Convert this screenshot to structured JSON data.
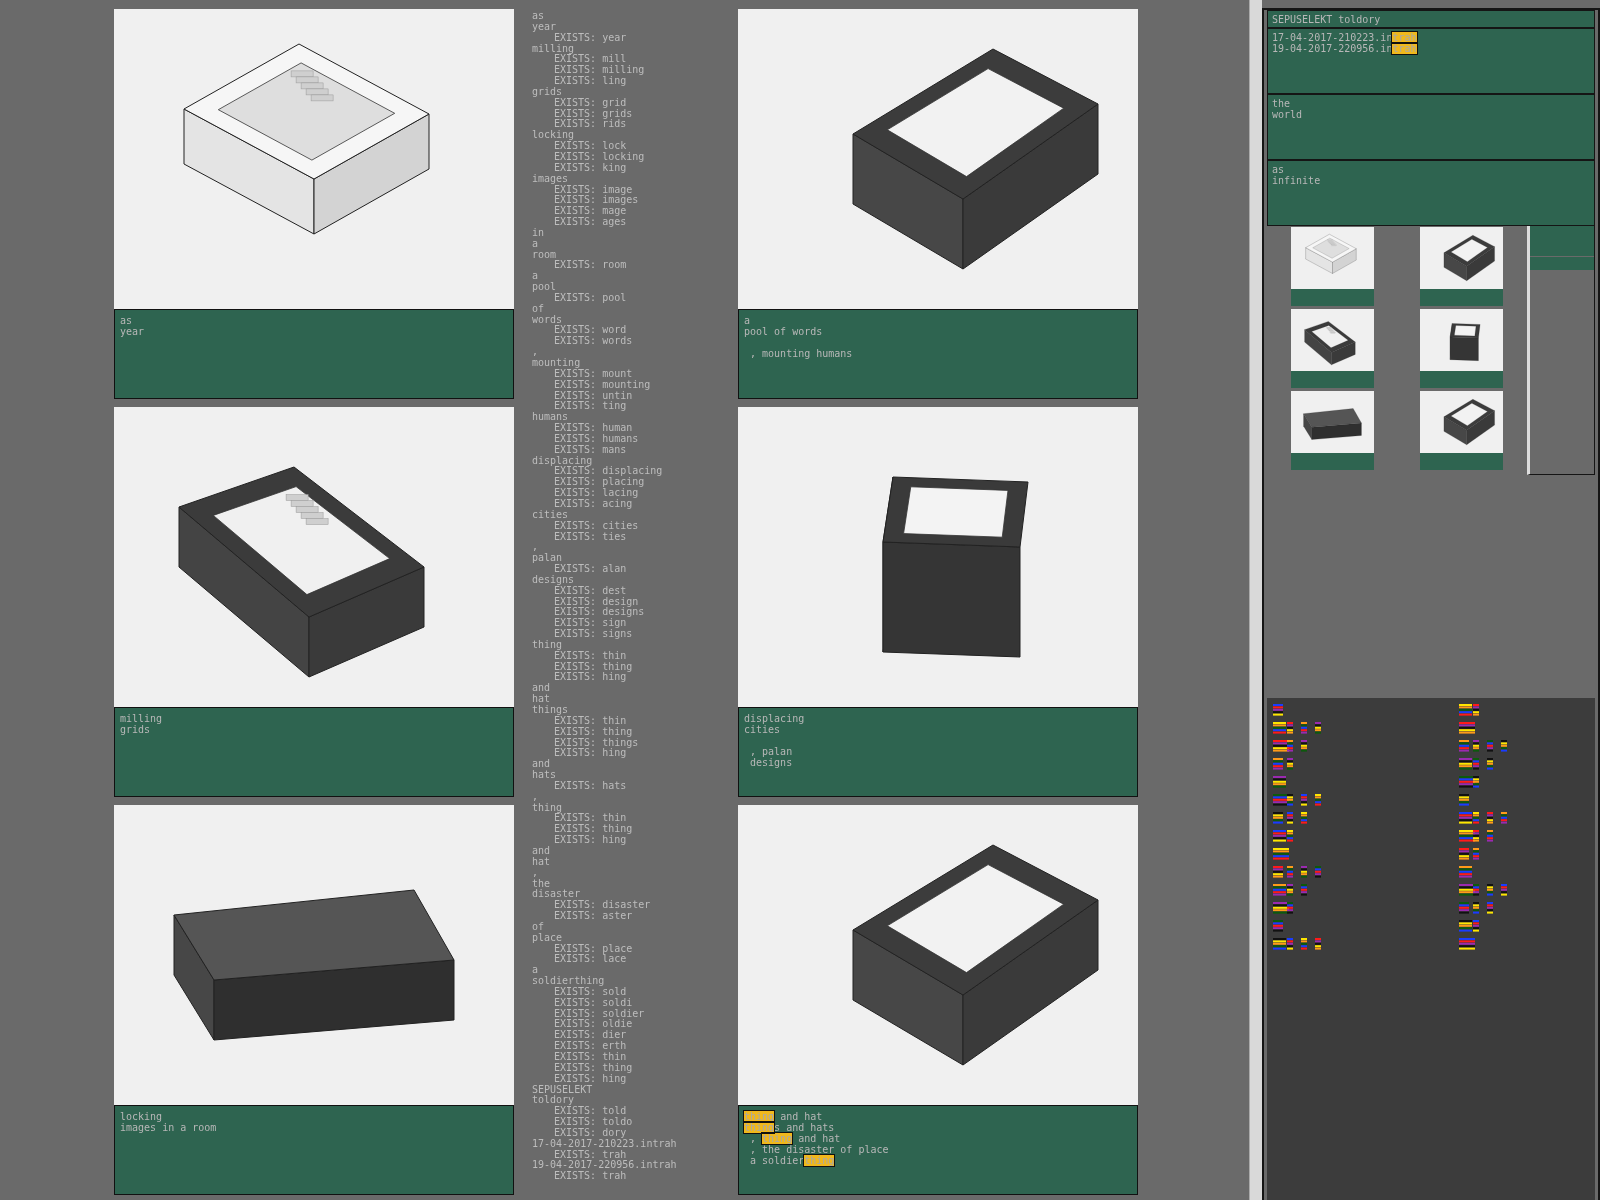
{
  "cards": [
    {
      "image": {
        "kind": "open-white"
      },
      "caption": [
        {
          "segments": [
            {
              "text": "as",
              "highlighted": false
            }
          ]
        },
        {
          "segments": [
            {
              "text": "year",
              "highlighted": false
            }
          ]
        }
      ]
    },
    {
      "image": {
        "kind": "open-dark"
      },
      "caption": [
        {
          "segments": [
            {
              "text": "a",
              "highlighted": false
            }
          ]
        },
        {
          "segments": [
            {
              "text": "pool of words",
              "highlighted": false
            }
          ]
        },
        {
          "gap_above": true,
          "segments": [
            {
              "text": " , mounting humans",
              "highlighted": false
            }
          ]
        }
      ]
    },
    {
      "image": {
        "kind": "open-dark-stairs"
      },
      "caption": [
        {
          "segments": [
            {
              "text": "milling",
              "highlighted": false
            }
          ]
        },
        {
          "segments": [
            {
              "text": "grids",
              "highlighted": false
            }
          ]
        }
      ]
    },
    {
      "image": {
        "kind": "tall-dark"
      },
      "caption": [
        {
          "segments": [
            {
              "text": "displacing",
              "highlighted": false
            }
          ]
        },
        {
          "segments": [
            {
              "text": "cities",
              "highlighted": false
            }
          ]
        },
        {
          "gap_above": true,
          "segments": [
            {
              "text": " , palan",
              "highlighted": false
            }
          ]
        },
        {
          "segments": [
            {
              "text": " designs",
              "highlighted": false
            }
          ]
        }
      ]
    },
    {
      "image": {
        "kind": "closed-dark"
      },
      "caption": [
        {
          "segments": [
            {
              "text": "locking",
              "highlighted": false
            }
          ]
        },
        {
          "segments": [
            {
              "text": "images in a room",
              "highlighted": false
            }
          ]
        }
      ]
    },
    {
      "image": {
        "kind": "open-dark"
      },
      "caption": [
        {
          "segments": [
            {
              "text": "thing",
              "highlighted": true
            },
            {
              "text": " and hat",
              "highlighted": false
            }
          ]
        },
        {
          "segments": [
            {
              "text": "thing",
              "highlighted": true
            },
            {
              "text": "s and hats",
              "highlighted": false
            }
          ]
        },
        {
          "segments": [
            {
              "text": " , ",
              "highlighted": false
            },
            {
              "text": "thing",
              "highlighted": true
            },
            {
              "text": " and hat",
              "highlighted": false
            }
          ]
        },
        {
          "segments": [
            {
              "text": " , the disaster of place",
              "highlighted": false
            }
          ]
        },
        {
          "segments": [
            {
              "text": " a soldier",
              "highlighted": false
            },
            {
              "text": "thing",
              "highlighted": true
            }
          ]
        }
      ]
    }
  ],
  "wordlist": [
    {
      "word": "as"
    },
    {
      "word": "year",
      "exists": [
        "EXISTS: year"
      ]
    },
    {
      "word": "milling",
      "exists": [
        "EXISTS: mill",
        "EXISTS: milling",
        "EXISTS: ling"
      ]
    },
    {
      "word": "grids",
      "exists": [
        "EXISTS: grid",
        "EXISTS: grids",
        "EXISTS: rids"
      ]
    },
    {
      "word": "locking",
      "exists": [
        "EXISTS: lock",
        "EXISTS: locking",
        "EXISTS: king"
      ]
    },
    {
      "word": "images",
      "exists": [
        "EXISTS: image",
        "EXISTS: images",
        "EXISTS: mage",
        "EXISTS: ages"
      ]
    },
    {
      "word": "in"
    },
    {
      "word": "a"
    },
    {
      "word": "room",
      "exists": [
        "EXISTS: room"
      ]
    },
    {
      "word": "a"
    },
    {
      "word": "pool",
      "exists": [
        "EXISTS: pool"
      ]
    },
    {
      "word": "of"
    },
    {
      "word": "words",
      "exists": [
        "EXISTS: word",
        "EXISTS: words"
      ]
    },
    {
      "word": ","
    },
    {
      "word": "mounting",
      "exists": [
        "EXISTS: mount",
        "EXISTS: mounting",
        "EXISTS: untin",
        "EXISTS: ting"
      ]
    },
    {
      "word": "humans",
      "exists": [
        "EXISTS: human",
        "EXISTS: humans",
        "EXISTS: mans"
      ]
    },
    {
      "word": "displacing",
      "exists": [
        "EXISTS: displacing",
        "EXISTS: placing",
        "EXISTS: lacing",
        "EXISTS: acing"
      ]
    },
    {
      "word": "cities",
      "exists": [
        "EXISTS: cities",
        "EXISTS: ties"
      ]
    },
    {
      "word": ","
    },
    {
      "word": "palan",
      "exists": [
        "EXISTS: alan"
      ]
    },
    {
      "word": "designs",
      "exists": [
        "EXISTS: dest",
        "EXISTS: design",
        "EXISTS: designs",
        "EXISTS: sign",
        "EXISTS: signs"
      ]
    },
    {
      "word": "thing",
      "exists": [
        "EXISTS: thin",
        "EXISTS: thing",
        "EXISTS: hing"
      ]
    },
    {
      "word": "and"
    },
    {
      "word": "hat"
    },
    {
      "word": "things",
      "exists": [
        "EXISTS: thin",
        "EXISTS: thing",
        "EXISTS: things",
        "EXISTS: hing"
      ]
    },
    {
      "word": "and"
    },
    {
      "word": "hats",
      "exists": [
        "EXISTS: hats"
      ]
    },
    {
      "word": ","
    },
    {
      "word": "thing",
      "exists": [
        "EXISTS: thin",
        "EXISTS: thing",
        "EXISTS: hing"
      ]
    },
    {
      "word": "and"
    },
    {
      "word": "hat"
    },
    {
      "word": ","
    },
    {
      "word": "the"
    },
    {
      "word": "disaster",
      "exists": [
        "EXISTS: disaster",
        "EXISTS: aster"
      ]
    },
    {
      "word": "of"
    },
    {
      "word": "place",
      "exists": [
        "EXISTS: place",
        "EXISTS: lace"
      ]
    },
    {
      "word": "a"
    },
    {
      "word": "soldierthing",
      "exists": [
        "EXISTS: sold",
        "EXISTS: soldi",
        "EXISTS: soldier",
        "EXISTS: oldie",
        "EXISTS: dier",
        "EXISTS: erth",
        "EXISTS: thin",
        "EXISTS: thing",
        "EXISTS: hing"
      ]
    },
    {
      "word": "SEPUSELEKT"
    },
    {
      "word": "toldory",
      "exists": [
        "EXISTS: told",
        "EXISTS: toldo",
        "EXISTS: dory"
      ]
    },
    {
      "word": "17-04-2017-210223.intrah",
      "exists": [
        "EXISTS: trah"
      ]
    },
    {
      "word": "19-04-2017-220956.intrah",
      "exists": [
        "EXISTS: trah"
      ]
    }
  ],
  "side_panel": {
    "header": "SEPUSELEKT toldory",
    "files": [
      [
        {
          "text": "17-04-2017-210223.in",
          "highlighted": false
        },
        {
          "text": "trah",
          "highlighted": true
        }
      ],
      [
        {
          "text": "19-04-2017-220956.in",
          "highlighted": false
        },
        {
          "text": "trah",
          "highlighted": true
        }
      ]
    ],
    "notes": [
      [
        "the",
        "world"
      ],
      [
        "as",
        "infinite"
      ]
    ],
    "thumbnails": [
      {
        "kind": "open-white"
      },
      {
        "kind": "open-dark"
      },
      {
        "kind": "open-dark-stairs"
      },
      {
        "kind": "tall-dark"
      },
      {
        "kind": "closed-dark"
      },
      {
        "kind": "open-dark"
      }
    ]
  }
}
